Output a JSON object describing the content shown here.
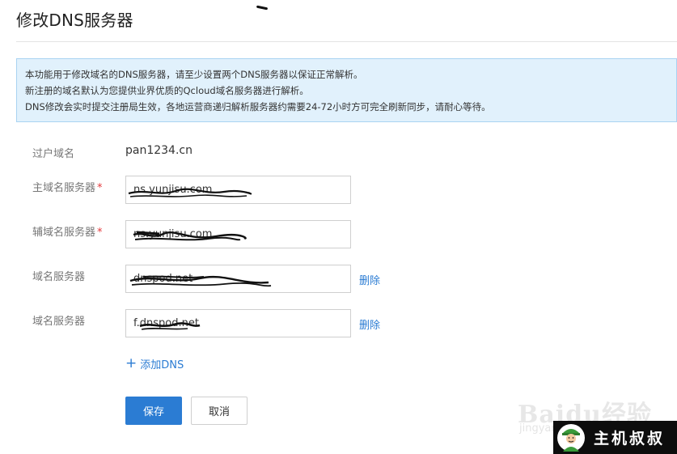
{
  "page": {
    "title": "修改DNS服务器"
  },
  "notice": {
    "lines": [
      "本功能用于修改域名的DNS服务器，请至少设置两个DNS服务器以保证正常解析。",
      "新注册的域名默认为您提供业界优质的Qcloud域名服务器进行解析。",
      "DNS修改会实时提交注册局生效，各地运营商递归解析服务器约需要24-72小时方可完全刷新同步，请耐心等待。"
    ]
  },
  "form": {
    "domain": {
      "label": "过户域名",
      "value": "pan1234.cn"
    },
    "primary": {
      "label": "主域名服务器",
      "required": "*",
      "value": "ns.yunjisu.com"
    },
    "secondary": {
      "label": "辅域名服务器",
      "required": "*",
      "value": "ns.yunjisu.com"
    },
    "server3": {
      "label": "域名服务器",
      "value": "dnspod.net",
      "delete_label": "删除"
    },
    "server4": {
      "label": "域名服务器",
      "value": "f.dnspod.net",
      "delete_label": "删除"
    },
    "add_label": "添加DNS",
    "add_icon": "+"
  },
  "actions": {
    "save_label": "保存",
    "cancel_label": "取消"
  },
  "watermark": {
    "text": "Baidu经验",
    "sub": "jingyan"
  },
  "badge": {
    "text": "主机叔叔"
  },
  "colors": {
    "primary": "#2b7cd3",
    "notice_bg": "#e1f1fc",
    "notice_border": "#a9d3f2",
    "required": "#e4393c"
  }
}
